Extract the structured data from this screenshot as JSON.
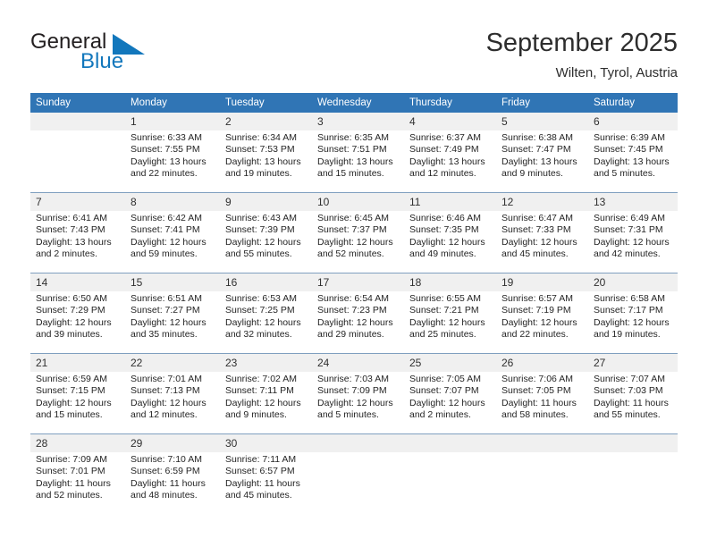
{
  "brand": {
    "name_part1": "General",
    "name_part2": "Blue",
    "triangle_color": "#1277bc",
    "text_color": "#231f20"
  },
  "header": {
    "title": "September 2025",
    "location": "Wilten, Tyrol, Austria",
    "accent_color": "#3075b5",
    "daynum_bg": "#f0f0f0"
  },
  "calendar": {
    "weekday_headers": [
      "Sunday",
      "Monday",
      "Tuesday",
      "Wednesday",
      "Thursday",
      "Friday",
      "Saturday"
    ],
    "weeks": [
      {
        "days": [
          {
            "num": "",
            "lines": [
              "",
              "",
              "",
              ""
            ]
          },
          {
            "num": "1",
            "lines": [
              "Sunrise: 6:33 AM",
              "Sunset: 7:55 PM",
              "Daylight: 13 hours",
              "and 22 minutes."
            ]
          },
          {
            "num": "2",
            "lines": [
              "Sunrise: 6:34 AM",
              "Sunset: 7:53 PM",
              "Daylight: 13 hours",
              "and 19 minutes."
            ]
          },
          {
            "num": "3",
            "lines": [
              "Sunrise: 6:35 AM",
              "Sunset: 7:51 PM",
              "Daylight: 13 hours",
              "and 15 minutes."
            ]
          },
          {
            "num": "4",
            "lines": [
              "Sunrise: 6:37 AM",
              "Sunset: 7:49 PM",
              "Daylight: 13 hours",
              "and 12 minutes."
            ]
          },
          {
            "num": "5",
            "lines": [
              "Sunrise: 6:38 AM",
              "Sunset: 7:47 PM",
              "Daylight: 13 hours",
              "and 9 minutes."
            ]
          },
          {
            "num": "6",
            "lines": [
              "Sunrise: 6:39 AM",
              "Sunset: 7:45 PM",
              "Daylight: 13 hours",
              "and 5 minutes."
            ]
          }
        ]
      },
      {
        "days": [
          {
            "num": "7",
            "lines": [
              "Sunrise: 6:41 AM",
              "Sunset: 7:43 PM",
              "Daylight: 13 hours",
              "and 2 minutes."
            ]
          },
          {
            "num": "8",
            "lines": [
              "Sunrise: 6:42 AM",
              "Sunset: 7:41 PM",
              "Daylight: 12 hours",
              "and 59 minutes."
            ]
          },
          {
            "num": "9",
            "lines": [
              "Sunrise: 6:43 AM",
              "Sunset: 7:39 PM",
              "Daylight: 12 hours",
              "and 55 minutes."
            ]
          },
          {
            "num": "10",
            "lines": [
              "Sunrise: 6:45 AM",
              "Sunset: 7:37 PM",
              "Daylight: 12 hours",
              "and 52 minutes."
            ]
          },
          {
            "num": "11",
            "lines": [
              "Sunrise: 6:46 AM",
              "Sunset: 7:35 PM",
              "Daylight: 12 hours",
              "and 49 minutes."
            ]
          },
          {
            "num": "12",
            "lines": [
              "Sunrise: 6:47 AM",
              "Sunset: 7:33 PM",
              "Daylight: 12 hours",
              "and 45 minutes."
            ]
          },
          {
            "num": "13",
            "lines": [
              "Sunrise: 6:49 AM",
              "Sunset: 7:31 PM",
              "Daylight: 12 hours",
              "and 42 minutes."
            ]
          }
        ]
      },
      {
        "days": [
          {
            "num": "14",
            "lines": [
              "Sunrise: 6:50 AM",
              "Sunset: 7:29 PM",
              "Daylight: 12 hours",
              "and 39 minutes."
            ]
          },
          {
            "num": "15",
            "lines": [
              "Sunrise: 6:51 AM",
              "Sunset: 7:27 PM",
              "Daylight: 12 hours",
              "and 35 minutes."
            ]
          },
          {
            "num": "16",
            "lines": [
              "Sunrise: 6:53 AM",
              "Sunset: 7:25 PM",
              "Daylight: 12 hours",
              "and 32 minutes."
            ]
          },
          {
            "num": "17",
            "lines": [
              "Sunrise: 6:54 AM",
              "Sunset: 7:23 PM",
              "Daylight: 12 hours",
              "and 29 minutes."
            ]
          },
          {
            "num": "18",
            "lines": [
              "Sunrise: 6:55 AM",
              "Sunset: 7:21 PM",
              "Daylight: 12 hours",
              "and 25 minutes."
            ]
          },
          {
            "num": "19",
            "lines": [
              "Sunrise: 6:57 AM",
              "Sunset: 7:19 PM",
              "Daylight: 12 hours",
              "and 22 minutes."
            ]
          },
          {
            "num": "20",
            "lines": [
              "Sunrise: 6:58 AM",
              "Sunset: 7:17 PM",
              "Daylight: 12 hours",
              "and 19 minutes."
            ]
          }
        ]
      },
      {
        "days": [
          {
            "num": "21",
            "lines": [
              "Sunrise: 6:59 AM",
              "Sunset: 7:15 PM",
              "Daylight: 12 hours",
              "and 15 minutes."
            ]
          },
          {
            "num": "22",
            "lines": [
              "Sunrise: 7:01 AM",
              "Sunset: 7:13 PM",
              "Daylight: 12 hours",
              "and 12 minutes."
            ]
          },
          {
            "num": "23",
            "lines": [
              "Sunrise: 7:02 AM",
              "Sunset: 7:11 PM",
              "Daylight: 12 hours",
              "and 9 minutes."
            ]
          },
          {
            "num": "24",
            "lines": [
              "Sunrise: 7:03 AM",
              "Sunset: 7:09 PM",
              "Daylight: 12 hours",
              "and 5 minutes."
            ]
          },
          {
            "num": "25",
            "lines": [
              "Sunrise: 7:05 AM",
              "Sunset: 7:07 PM",
              "Daylight: 12 hours",
              "and 2 minutes."
            ]
          },
          {
            "num": "26",
            "lines": [
              "Sunrise: 7:06 AM",
              "Sunset: 7:05 PM",
              "Daylight: 11 hours",
              "and 58 minutes."
            ]
          },
          {
            "num": "27",
            "lines": [
              "Sunrise: 7:07 AM",
              "Sunset: 7:03 PM",
              "Daylight: 11 hours",
              "and 55 minutes."
            ]
          }
        ]
      },
      {
        "days": [
          {
            "num": "28",
            "lines": [
              "Sunrise: 7:09 AM",
              "Sunset: 7:01 PM",
              "Daylight: 11 hours",
              "and 52 minutes."
            ]
          },
          {
            "num": "29",
            "lines": [
              "Sunrise: 7:10 AM",
              "Sunset: 6:59 PM",
              "Daylight: 11 hours",
              "and 48 minutes."
            ]
          },
          {
            "num": "30",
            "lines": [
              "Sunrise: 7:11 AM",
              "Sunset: 6:57 PM",
              "Daylight: 11 hours",
              "and 45 minutes."
            ]
          },
          {
            "num": "",
            "lines": [
              "",
              "",
              "",
              ""
            ]
          },
          {
            "num": "",
            "lines": [
              "",
              "",
              "",
              ""
            ]
          },
          {
            "num": "",
            "lines": [
              "",
              "",
              "",
              ""
            ]
          },
          {
            "num": "",
            "lines": [
              "",
              "",
              "",
              ""
            ]
          }
        ]
      }
    ]
  }
}
